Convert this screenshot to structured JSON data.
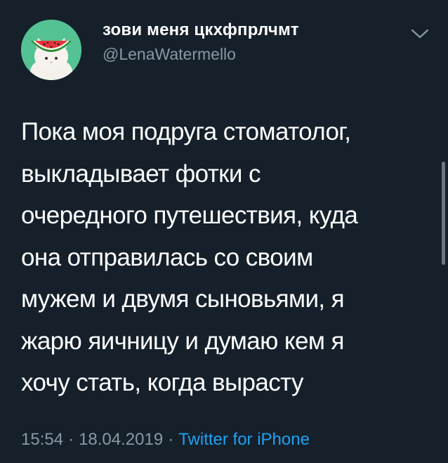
{
  "tweet": {
    "author": {
      "display_name": "зови меня цкхфпрлчмт",
      "handle": "@LenaWatermello",
      "avatar_icon": "cat-watermelon-hat-avatar"
    },
    "menu_icon": "chevron-down-icon",
    "text_lines": [
      "Пока моя подруга стоматолог,",
      "выкладывает фотки с",
      "очередного путешествия, куда",
      "она отправилась со своим",
      "мужем и двумя сыновьями, я",
      "жарю яичницу и думаю кем я",
      "хочу стать, когда вырасту"
    ],
    "time": "15:54",
    "date": "18.04.2019",
    "separator": "·",
    "source": "Twitter for iPhone"
  },
  "colors": {
    "background": "#15202b",
    "text": "#ffffff",
    "secondary": "#8899a6",
    "link": "#1da1f2",
    "avatar_bg": "#55c294"
  }
}
